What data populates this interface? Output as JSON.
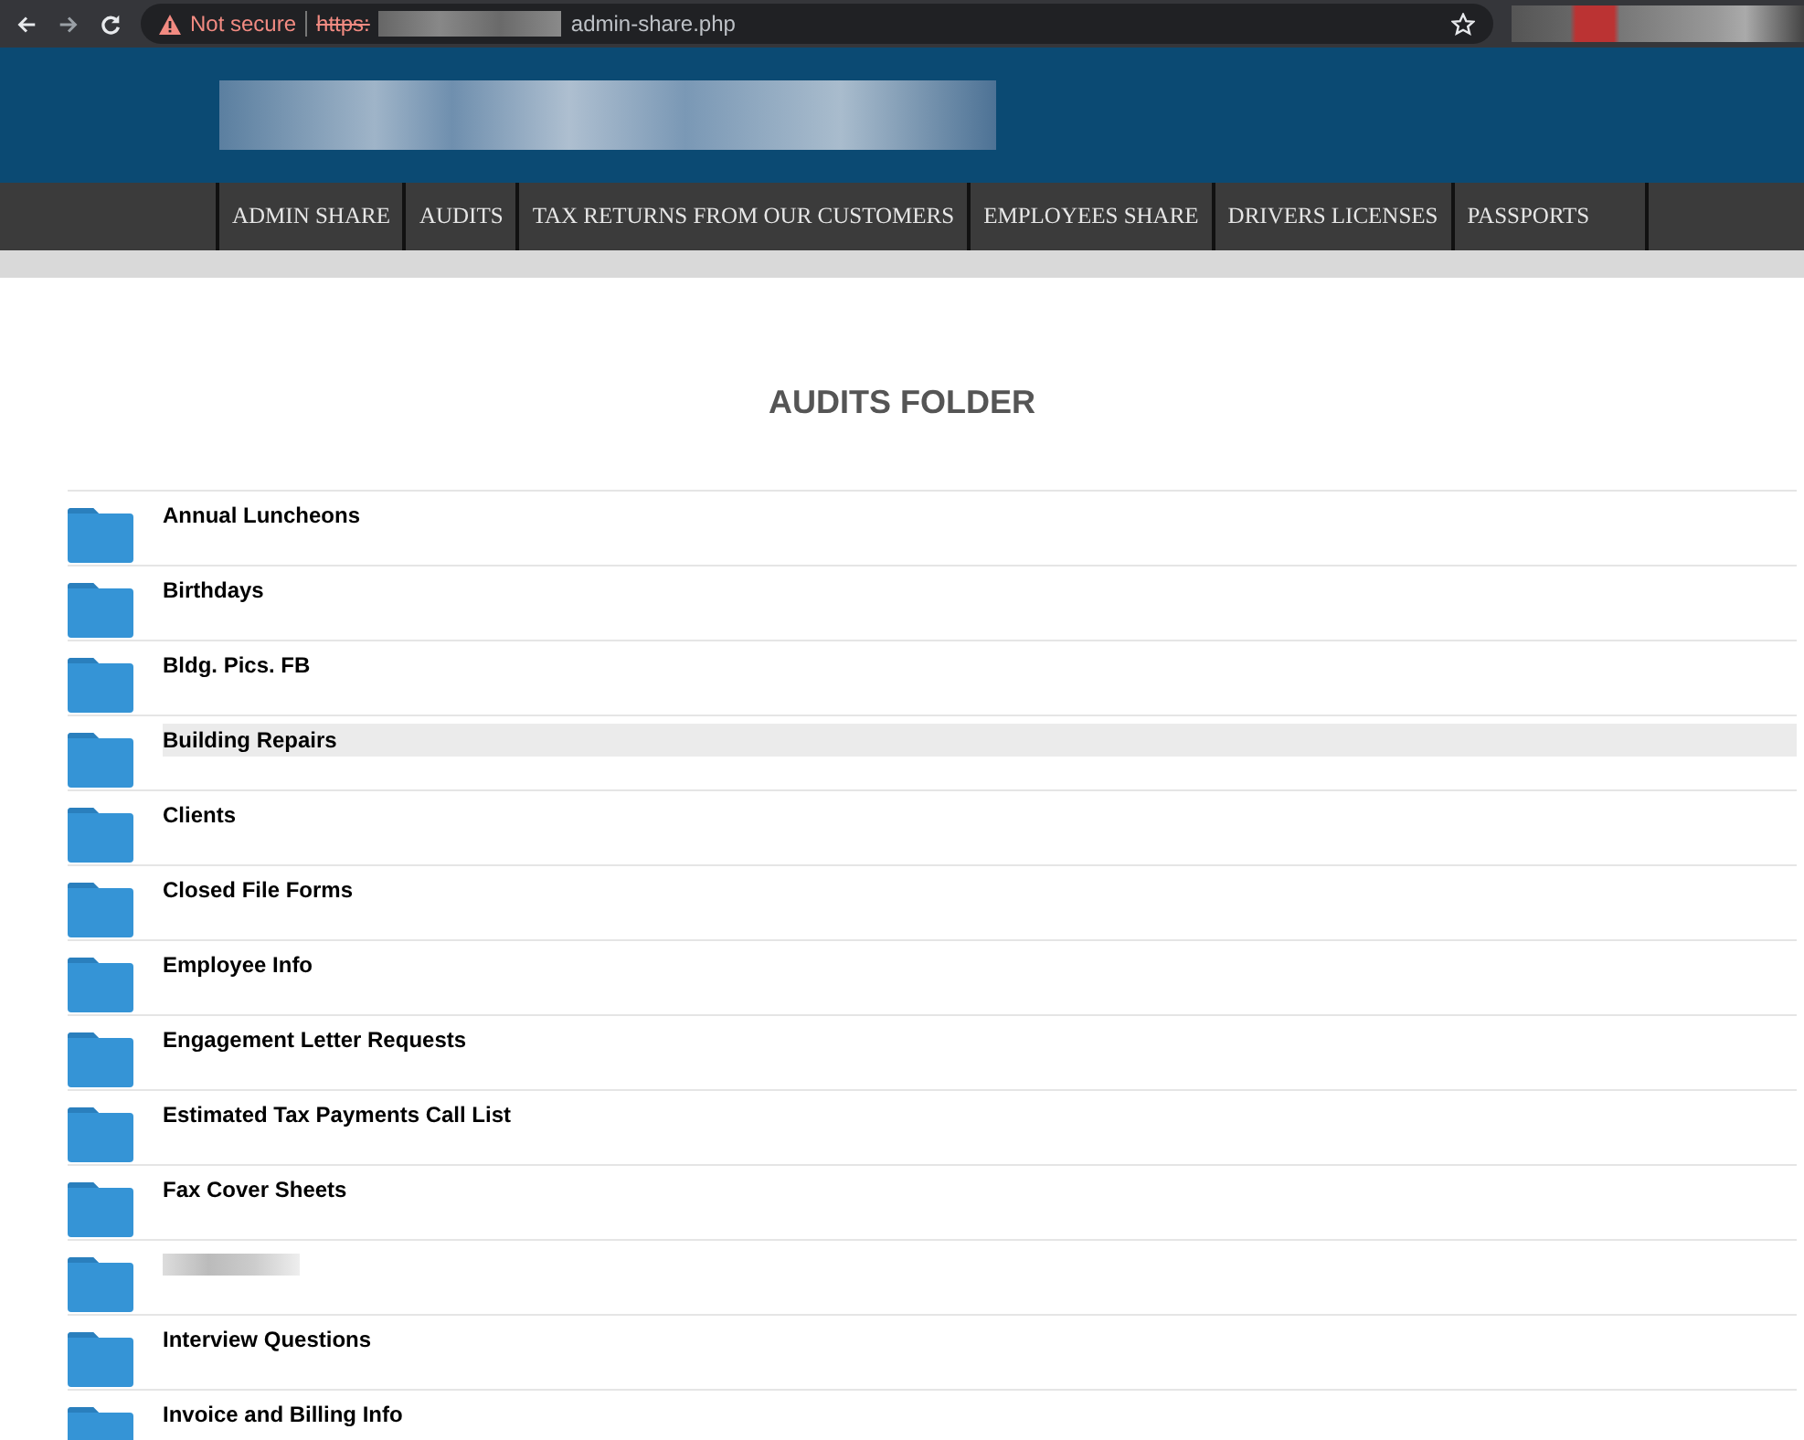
{
  "browser": {
    "security_label": "Not secure",
    "url_scheme": "https:",
    "url_path": "admin-share.php"
  },
  "nav": [
    {
      "label": "ADMIN SHARE",
      "selected": false
    },
    {
      "label": "AUDITS",
      "selected": false
    },
    {
      "label": "TAX RETURNS FROM OUR CUSTOMERS",
      "selected": false
    },
    {
      "label": "EMPLOYEES SHARE",
      "selected": false
    },
    {
      "label": "DRIVERS LICENSES",
      "selected": false
    },
    {
      "label": "PASSPORTS",
      "selected": false
    }
  ],
  "heading": "AUDITS FOLDER",
  "folders": [
    {
      "kind": "named",
      "name": "Annual Luncheons",
      "highlighted": false
    },
    {
      "kind": "named",
      "name": "Birthdays",
      "highlighted": false
    },
    {
      "kind": "named",
      "name": "Bldg. Pics. FB",
      "highlighted": false
    },
    {
      "kind": "named",
      "name": "Building Repairs",
      "highlighted": true
    },
    {
      "kind": "named",
      "name": "Clients",
      "highlighted": false
    },
    {
      "kind": "named",
      "name": "Closed File Forms",
      "highlighted": false
    },
    {
      "kind": "named",
      "name": "Employee Info",
      "highlighted": false
    },
    {
      "kind": "named",
      "name": "Engagement Letter Requests",
      "highlighted": false
    },
    {
      "kind": "named",
      "name": "Estimated Tax Payments Call List",
      "highlighted": false
    },
    {
      "kind": "named",
      "name": "Fax Cover Sheets",
      "highlighted": false
    },
    {
      "kind": "redacted",
      "highlighted": false
    },
    {
      "kind": "named",
      "name": "Interview Questions",
      "highlighted": false
    },
    {
      "kind": "named",
      "name": "Invoice and Billing Info",
      "highlighted": false
    }
  ]
}
